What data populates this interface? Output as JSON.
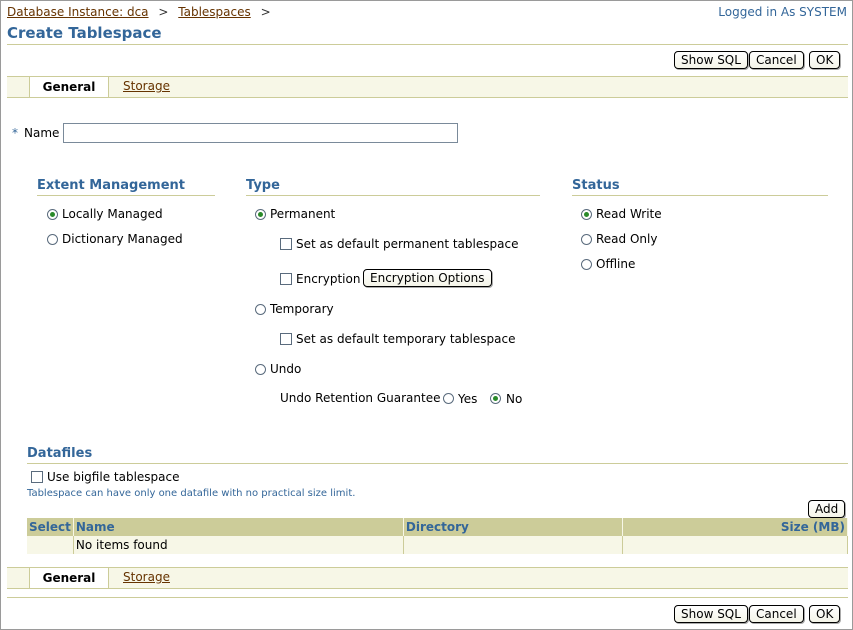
{
  "header": {
    "breadcrumb": [
      "Database Instance: dca",
      "Tablespaces"
    ],
    "breadcrumb_sep": ">",
    "logged_in": "Logged in As SYSTEM",
    "page_title": "Create Tablespace"
  },
  "buttons": {
    "show_sql": "Show SQL",
    "cancel": "Cancel",
    "ok": "OK",
    "add": "Add",
    "encryption_options": "Encryption Options"
  },
  "tabs": [
    {
      "label": "General",
      "active": true
    },
    {
      "label": "Storage",
      "active": false
    }
  ],
  "name_field": {
    "required_mark": "*",
    "label": "Name",
    "value": ""
  },
  "extent": {
    "title": "Extent Management",
    "options": [
      {
        "label": "Locally Managed",
        "selected": true
      },
      {
        "label": "Dictionary Managed",
        "selected": false
      }
    ]
  },
  "type": {
    "title": "Type",
    "permanent": "Permanent",
    "default_permanent": "Set as default permanent tablespace",
    "encryption": "Encryption",
    "temporary": "Temporary",
    "default_temporary": "Set as default temporary tablespace",
    "undo": "Undo",
    "undo_retention": "Undo Retention Guarantee",
    "yes": "Yes",
    "no": "No"
  },
  "status": {
    "title": "Status",
    "options": [
      {
        "label": "Read Write",
        "selected": true
      },
      {
        "label": "Read Only",
        "selected": false
      },
      {
        "label": "Offline",
        "selected": false
      }
    ]
  },
  "datafiles": {
    "title": "Datafiles",
    "bigfile": "Use bigfile tablespace",
    "hint": "Tablespace can have only one datafile with no practical size limit.",
    "columns": [
      "Select",
      "Name",
      "Directory",
      "Size (MB)"
    ],
    "empty": "No items found"
  },
  "colors": {
    "accent": "#336699",
    "link": "#663300",
    "table_header": "#cccc99",
    "band": "#f7f7e7"
  }
}
